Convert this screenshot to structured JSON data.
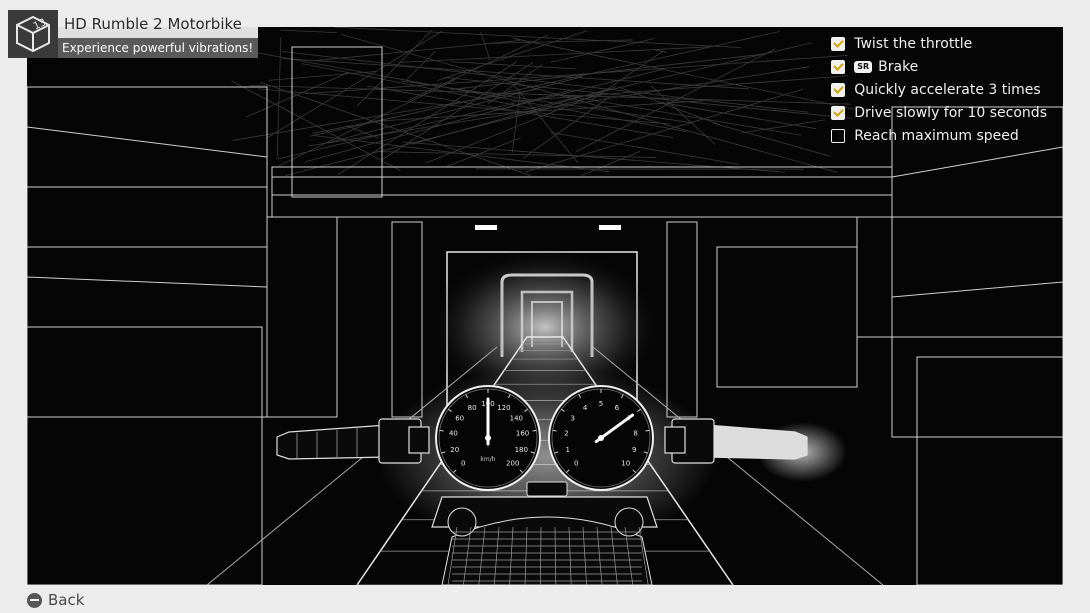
{
  "header": {
    "title": "HD Rumble 2 Motorbike",
    "subtitle": "Experience powerful vibrations!",
    "icon": "cube-13-icon",
    "icon_number": "13"
  },
  "checklist": [
    {
      "label": "Twist the throttle",
      "checked": true,
      "badge": ""
    },
    {
      "label": "Brake",
      "checked": true,
      "badge": "SR"
    },
    {
      "label": "Quickly accelerate 3 times",
      "checked": true,
      "badge": ""
    },
    {
      "label": "Drive slowly for 10 seconds",
      "checked": true,
      "badge": ""
    },
    {
      "label": "Reach maximum speed",
      "checked": false,
      "badge": ""
    }
  ],
  "speedometer": {
    "labels": [
      "0",
      "20",
      "40",
      "60",
      "80",
      "100",
      "120",
      "140",
      "160",
      "180",
      "200"
    ],
    "unit": "km/h",
    "needle_value": 100
  },
  "tachometer": {
    "labels": [
      "0",
      "1",
      "2",
      "3",
      "4",
      "5",
      "6",
      "7",
      "8",
      "9",
      "10"
    ],
    "needle_value": 7
  },
  "footer": {
    "back_label": "Back",
    "back_icon": "minus-button-icon"
  },
  "colors": {
    "check_accent": "#d4a300",
    "background": "#ececec",
    "scene": "#050505"
  }
}
